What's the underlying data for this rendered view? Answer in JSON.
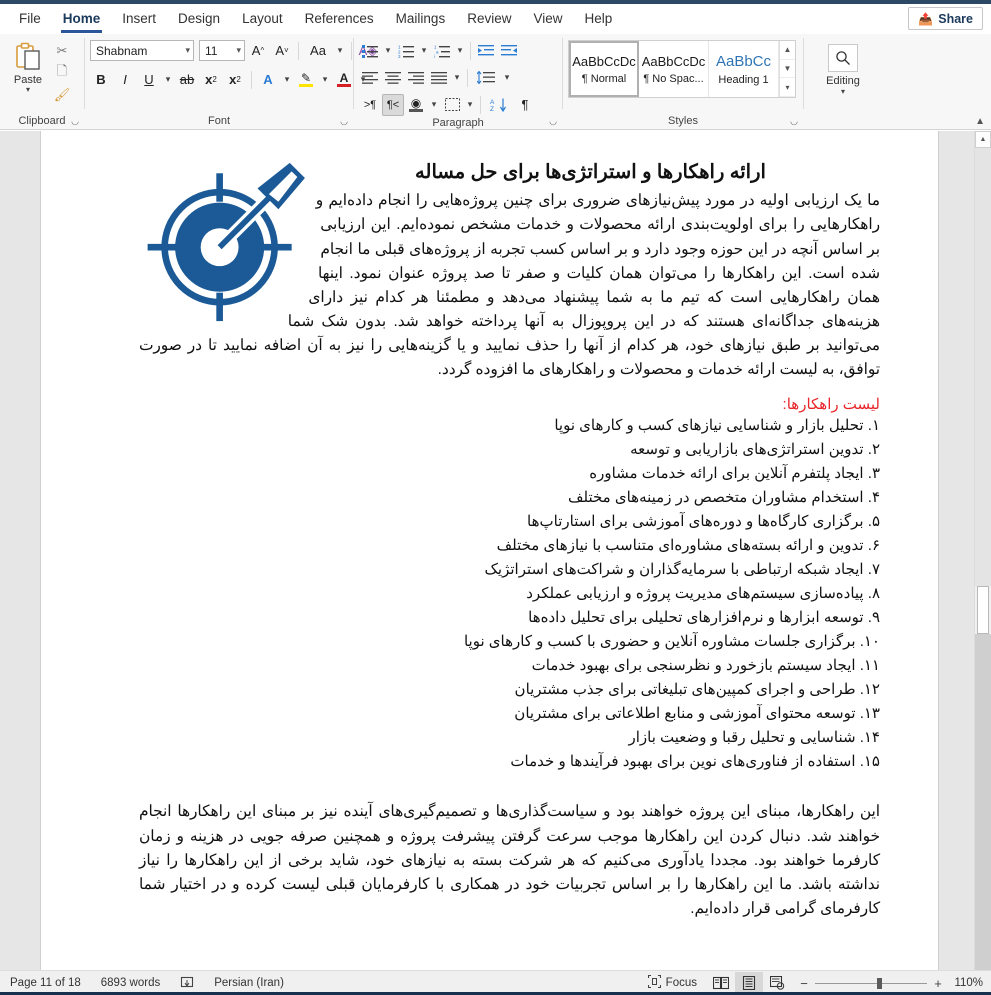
{
  "window": {
    "tabs": [
      {
        "label": "File",
        "active": false
      },
      {
        "label": "Home",
        "active": true
      },
      {
        "label": "Insert",
        "active": false
      },
      {
        "label": "Design",
        "active": false
      },
      {
        "label": "Layout",
        "active": false
      },
      {
        "label": "References",
        "active": false
      },
      {
        "label": "Mailings",
        "active": false
      },
      {
        "label": "Review",
        "active": false
      },
      {
        "label": "View",
        "active": false
      },
      {
        "label": "Help",
        "active": false
      }
    ],
    "share_label": "Share",
    "accent_color": "#2b579a",
    "top_strip_color": "#2b4865"
  },
  "ribbon": {
    "clipboard": {
      "group_label": "Clipboard",
      "paste_label": "Paste",
      "cut_label": "Cut",
      "copy_label": "Copy",
      "format_painter_label": "Format Painter"
    },
    "font": {
      "group_label": "Font",
      "font_name": "Shabnam",
      "font_size": "11",
      "grow_label": "A",
      "shrink_label": "A",
      "change_case_label": "Aa",
      "clear_formatting_label": "A",
      "bold_label": "B",
      "italic_label": "I",
      "underline_label": "U",
      "strikethrough_label": "ab",
      "subscript_label": "x",
      "superscript_label": "x",
      "text_effects_label": "A",
      "highlight_label": "A",
      "font_color_label": "A"
    },
    "paragraph": {
      "group_label": "Paragraph",
      "bullets_label": "Bullets",
      "numbering_label": "Numbering",
      "multilevel_label": "Multilevel List",
      "decrease_indent_label": "Decrease Indent",
      "increase_indent_label": "Increase Indent",
      "align_left_label": "Align Left",
      "align_center_label": "Center",
      "align_right_label": "Align Right",
      "justify_label": "Justify",
      "line_spacing_label": "Line and Paragraph Spacing",
      "ltr_label": "Left-to-Right Text Direction",
      "rtl_label": "Right-to-Left Text Direction",
      "shading_label": "Shading",
      "borders_label": "Borders",
      "sort_label": "Sort",
      "show_marks_label": "Show/Hide"
    },
    "styles": {
      "group_label": "Styles",
      "items": [
        {
          "preview": "AaBbCcDc",
          "name": "¶ Normal",
          "selected": true
        },
        {
          "preview": "AaBbCcDc",
          "name": "¶ No Spac...",
          "selected": false
        },
        {
          "preview": "AaBbCc",
          "name": "Heading 1",
          "selected": false
        }
      ]
    },
    "editing": {
      "group_label": "Editing",
      "label": "Editing"
    }
  },
  "document": {
    "title": "ارائه راهکارها و استراتژی‌ها برای حل مساله",
    "paragraph_1": "ما یک ارزیابی اولیه در مورد پیش‌نیازهای ضروری برای چنین پروژه‌هایی را انجام داده‌ایم و راهکارهایی را برای اولویت‌بندی ارائه محصولات و خدمات مشخص نموده‌ایم. این ارزیابی بر اساس آنچه در این حوزه وجود دارد و بر اساس کسب تجربه از پروژه‌های قبلی ما انجام شده است. این راهکارها را می‌توان همان کلیات و صفر تا صد پروژه عنوان نمود. اینها همان راهکارهایی است که تیم ما به شما پیشنهاد می‌دهد و مطمئنا هر کدام نیز دارای هزینه‌های جداگانه‌ای هستند که در این پروپوزال به آنها پرداخته خواهد شد. بدون شک شما می‌توانید بر طبق نیازهای خود، هر کدام از آنها را حذف نمایید و یا گزینه‌هایی را نیز به آن اضافه نمایید تا در صورت توافق، به لیست ارائه خدمات و محصولات و راهکارهای ما افزوده گردد.",
    "list_heading": "لیست راهکارها:",
    "list_items": [
      "۱. تحلیل بازار و شناسایی نیازهای کسب و کارهای نوپا",
      "۲. تدوین استراتژی‌های بازاریابی و توسعه",
      "۳. ایجاد پلتفرم آنلاین برای ارائه خدمات مشاوره",
      "۴. استخدام مشاوران متخصص در زمینه‌های مختلف",
      "۵. برگزاری کارگاه‌ها و دوره‌های آموزشی برای استارتاپ‌ها",
      "۶. تدوین و ارائه بسته‌های مشاوره‌ای متناسب با نیازهای مختلف",
      "۷. ایجاد شبکه ارتباطی با سرمایه‌گذاران و شراکت‌های استراتژیک",
      "۸. پیاده‌سازی سیستم‌های مدیریت پروژه و ارزیابی عملکرد",
      "۹. توسعه ابزارها و نرم‌افزارهای تحلیلی برای تحلیل داده‌ها",
      "۱۰. برگزاری جلسات مشاوره آنلاین و حضوری با کسب و کارهای نوپا",
      "۱۱. ایجاد سیستم بازخورد و نظرسنجی برای بهبود خدمات",
      "۱۲. طراحی و اجرای کمپین‌های تبلیغاتی برای جذب مشتریان",
      "۱۳. توسعه محتوای آموزشی و منابع اطلاعاتی برای مشتریان",
      "۱۴. شناسایی و تحلیل رقبا و وضعیت بازار",
      "۱۵. استفاده از فناوری‌های نوین برای بهبود فرآیندها و خدمات"
    ],
    "paragraph_2": "این راهکارها، مبنای این پروژه خواهند بود و سیاست‌گذاری‌ها و تصمیم‌گیری‌های آینده نیز بر مبنای این راهکارها انجام خواهند شد. دنبال کردن این راهکارها موجب سرعت گرفتن پیشرفت پروژه و همچنین صرفه جویی در هزینه و زمان کارفرما خواهند بود. مجددا یادآوری می‌کنیم که هر شرکت بسته به نیازهای خود، شاید برخی از این راهکارها را نیاز نداشته باشد. ما این راهکارها را بر اساس تجربیات خود در همکاری با کارفرمایان قبلی لیست کرده و در اختیار شما کارفرمای گرامی قرار داده‌ایم.",
    "image_alt": "target-with-arrow",
    "image_color": "#1b5a96",
    "heading_color": "#e8252a"
  },
  "statusbar": {
    "page_info": "Page 11 of 18",
    "word_count": "6893 words",
    "proofing_label": "proofing-errors",
    "language": "Persian (Iran)",
    "focus_label": "Focus",
    "view_read_label": "Read Mode",
    "view_print_label": "Print Layout",
    "view_web_label": "Web Layout",
    "zoom_out_label": "−",
    "zoom_in_label": "+",
    "zoom_value": "110%"
  }
}
